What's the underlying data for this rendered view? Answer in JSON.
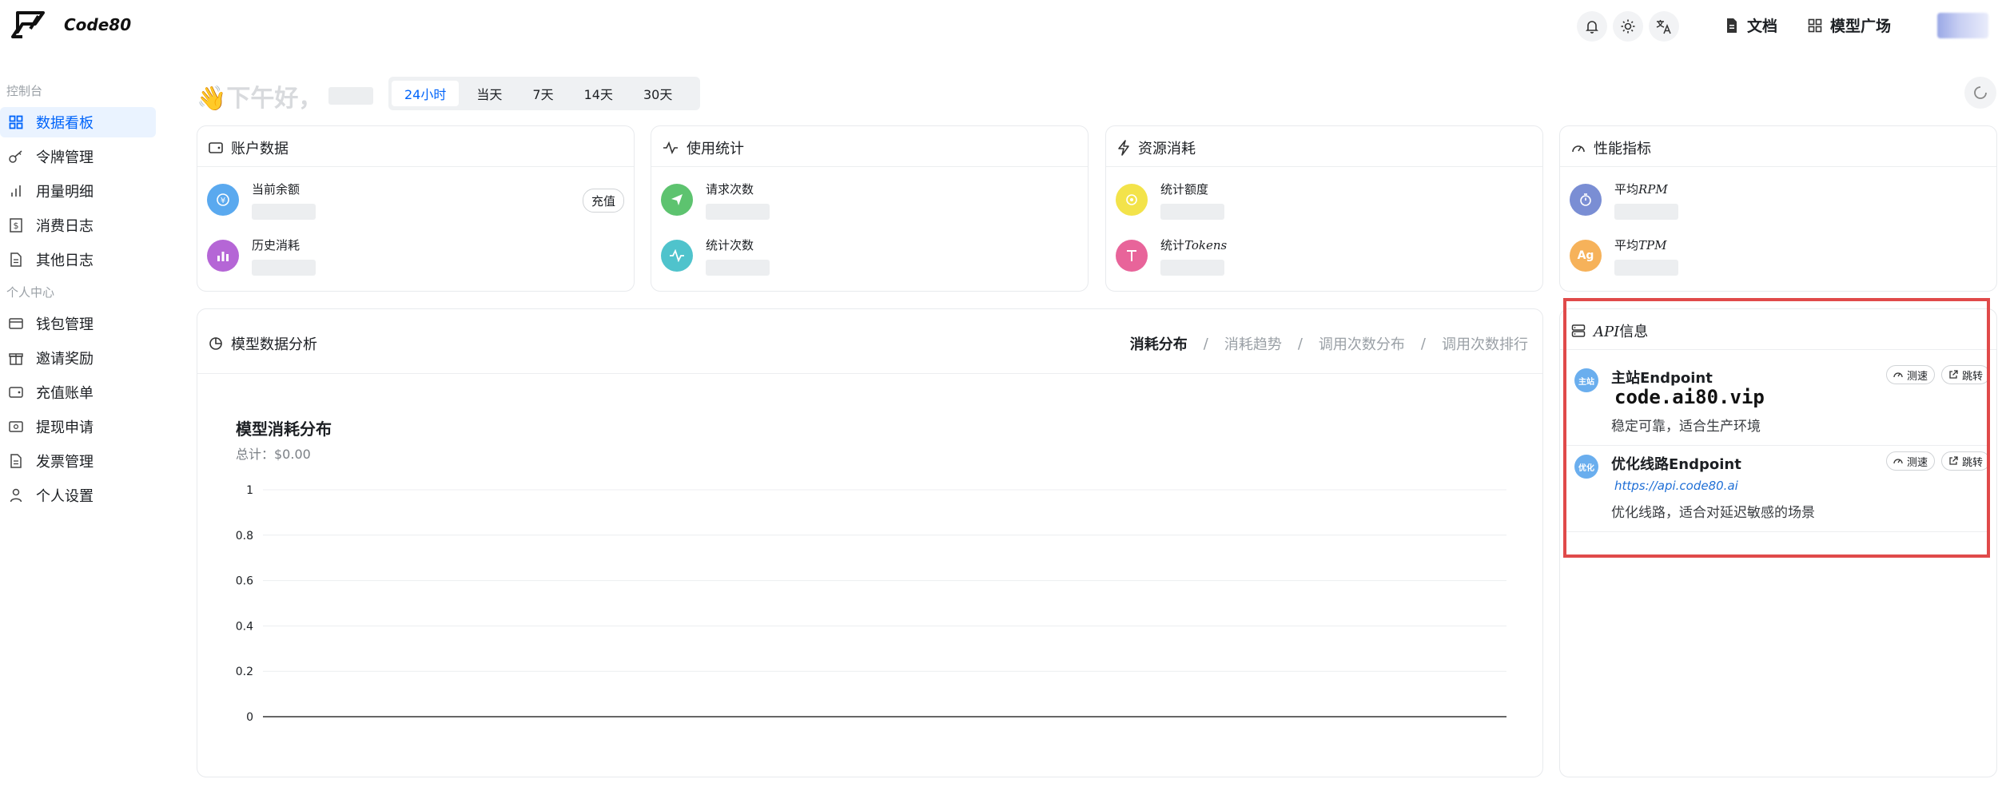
{
  "app": {
    "name": "Code80"
  },
  "header": {
    "icons": [
      "bell-icon",
      "sun-icon",
      "translate-icon"
    ],
    "docs_label": "文档",
    "models_label": "模型广场"
  },
  "sidebar": {
    "group1": "控制台",
    "items1": [
      {
        "label": "数据看板",
        "icon": "grid-icon",
        "active": true
      },
      {
        "label": "令牌管理",
        "icon": "key-icon"
      },
      {
        "label": "用量明细",
        "icon": "bar-chart-icon"
      },
      {
        "label": "消费日志",
        "icon": "dollar-receipt-icon"
      },
      {
        "label": "其他日志",
        "icon": "document-icon"
      }
    ],
    "group2": "个人中心",
    "items2": [
      {
        "label": "钱包管理",
        "icon": "card-icon"
      },
      {
        "label": "邀请奖励",
        "icon": "gift-icon"
      },
      {
        "label": "充值账单",
        "icon": "wallet-icon"
      },
      {
        "label": "提现申请",
        "icon": "cash-icon"
      },
      {
        "label": "发票管理",
        "icon": "invoice-icon"
      },
      {
        "label": "个人设置",
        "icon": "user-icon"
      }
    ]
  },
  "greeting": {
    "text": "👋下午好，"
  },
  "ranges": {
    "tabs": [
      "24小时",
      "当天",
      "7天",
      "14天",
      "30天"
    ],
    "active": "24小时"
  },
  "cards": {
    "account": {
      "title": "账户数据",
      "balance_label": "当前余额",
      "recharge_label": "充值",
      "history_label": "历史消耗"
    },
    "usage": {
      "title": "使用统计",
      "requests_label": "请求次数",
      "count_label": "统计次数"
    },
    "resource": {
      "title": "资源消耗",
      "quota_label": "统计额度",
      "tokens_prefix": "统计",
      "tokens_suffix": "Tokens"
    },
    "perf": {
      "title": "性能指标",
      "rpm_prefix": "平均",
      "rpm_suffix": "RPM",
      "tpm_prefix": "平均",
      "tpm_suffix": "TPM",
      "tpm_icon_text": "Ag"
    }
  },
  "model_analysis": {
    "title": "模型数据分析",
    "tabs": [
      "消耗分布",
      "消耗趋势",
      "调用次数分布",
      "调用次数排行"
    ],
    "active_tab": "消耗分布",
    "chart_title": "模型消耗分布",
    "chart_subtitle": "总计：$0.00"
  },
  "chart_data": {
    "type": "bar",
    "title": "模型消耗分布",
    "subtitle": "总计：$0.00",
    "categories": [],
    "series": [],
    "ylim": [
      0,
      1
    ],
    "yticks": [
      "0",
      "0.2",
      "0.4",
      "0.6",
      "0.8",
      "1"
    ],
    "grid": true
  },
  "api": {
    "title_prefix": "API",
    "title_suffix": "信息",
    "items": [
      {
        "badge": "主站",
        "name": "主站Endpoint",
        "url": "code.ai80.vip",
        "desc": "稳定可靠，适合生产环境",
        "test": "测速",
        "jump": "跳转"
      },
      {
        "badge": "优化",
        "name": "优化线路Endpoint",
        "url": "https://api.code80.ai",
        "desc": "优化线路，适合对延迟敏感的场景",
        "test": "测速",
        "jump": "跳转"
      }
    ]
  },
  "colors": {
    "accent": "#0064fa",
    "highlight": "#e04a4a"
  }
}
